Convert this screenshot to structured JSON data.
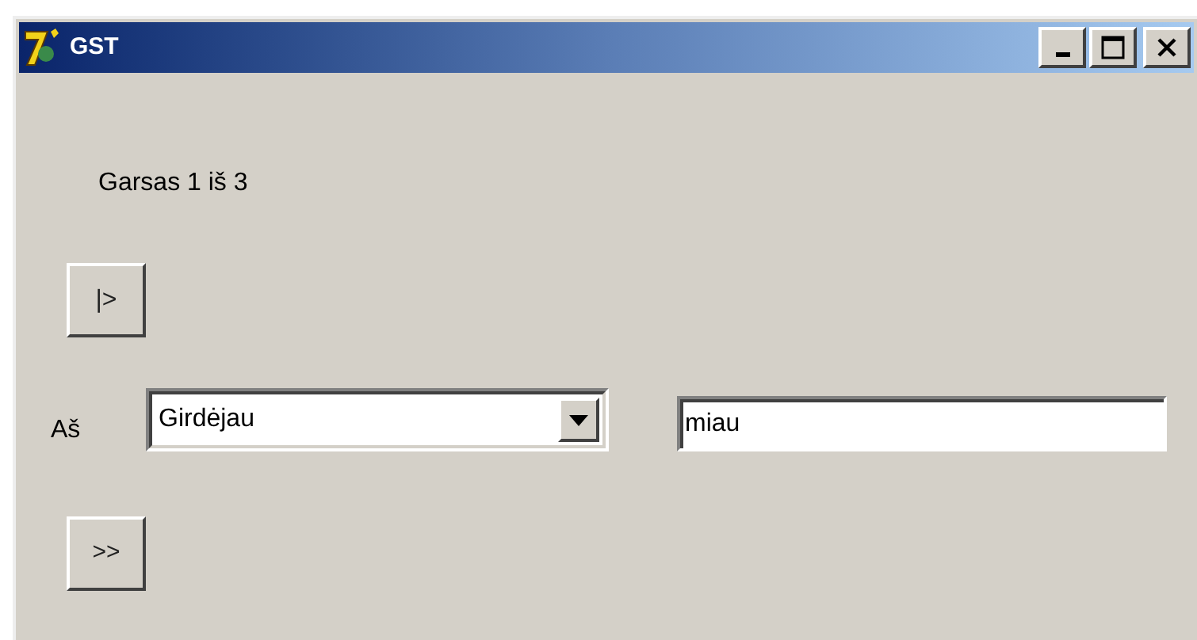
{
  "window": {
    "title": "GST"
  },
  "counter": "Garsas 1 iš 3",
  "play_button": "|>",
  "answer": {
    "label": "Aš",
    "dropdown_value": "Girdėjau",
    "text_value": "miau"
  },
  "next_button": ">>"
}
